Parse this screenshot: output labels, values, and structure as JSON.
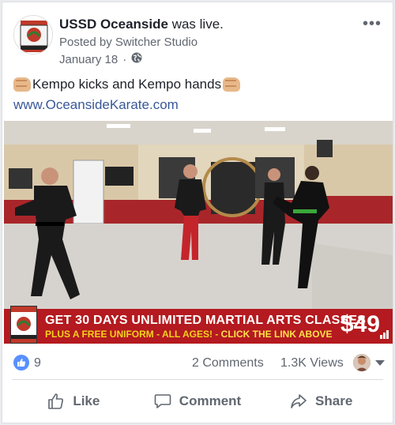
{
  "post": {
    "page_name": "USSD Oceanside",
    "status": "was live.",
    "posted_by": "Posted by Switcher Studio",
    "date": "January 18",
    "date_separator": "·",
    "text": "Kempo kicks and Kempo hands",
    "link": "www.OceansideKarate.com",
    "more_label": "•••"
  },
  "video": {
    "banner": {
      "line1": "GET 30 DAYS UNLIMITED MARTIAL ARTS CLASSES",
      "line2_a": "PLUS A FREE UNIFORM - ALL AGES! - ",
      "line2_b": "CLICK THE LINK ABOVE",
      "price": "$49"
    }
  },
  "stats": {
    "likes": "9",
    "comments": "2 Comments",
    "views": "1.3K Views"
  },
  "actions": {
    "like": "Like",
    "comment": "Comment",
    "share": "Share"
  },
  "icons": {
    "like": "thumbs-up-icon",
    "comment": "speech-bubble-icon",
    "share": "share-arrow-icon",
    "audience": "globe-icon",
    "emoji": "fist-bump-emoji"
  },
  "colors": {
    "link": "#385898",
    "like_badge": "#5890ff",
    "banner_red": "#b41a1f",
    "banner_yellow": "#f2d21c"
  }
}
